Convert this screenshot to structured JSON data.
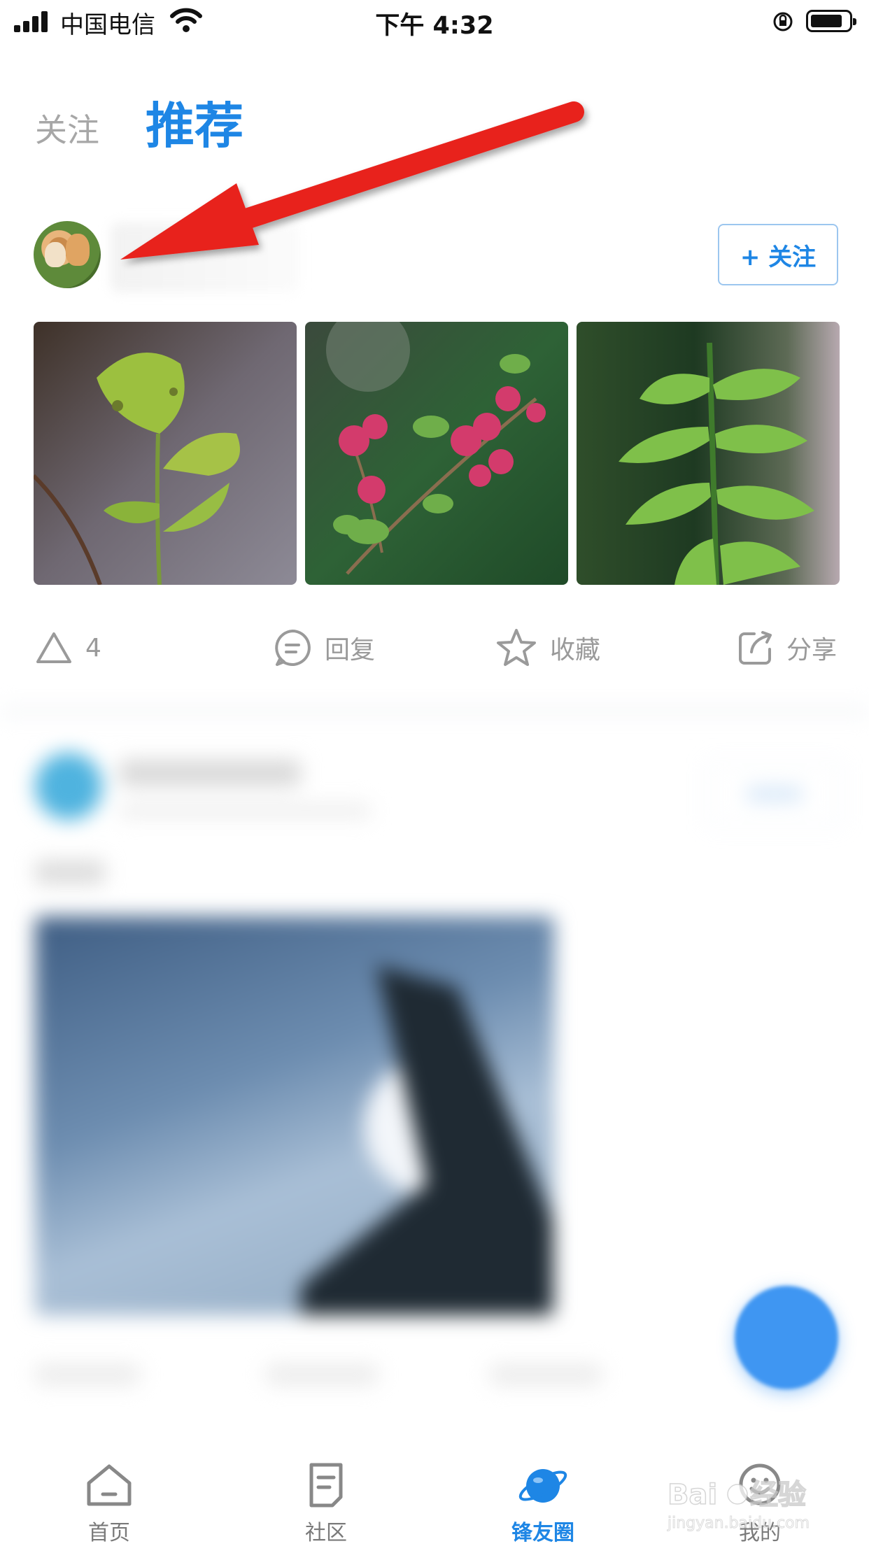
{
  "status_bar": {
    "carrier": "中国电信",
    "time": "下午 4:32"
  },
  "top_tabs": {
    "follow": "关注",
    "recommend": "推荐"
  },
  "post": {
    "follow_button": "+ 关注",
    "photos": [
      "leaf-photo",
      "bougainvillea-photo",
      "green-leaves-photo"
    ],
    "actions": {
      "like_count": "4",
      "reply": "回复",
      "favorite": "收藏",
      "share": "分享"
    }
  },
  "bottom_nav": {
    "items": [
      {
        "label": "首页",
        "icon": "home-icon"
      },
      {
        "label": "社区",
        "icon": "community-icon"
      },
      {
        "label": "锋友圈",
        "icon": "planet-icon"
      },
      {
        "label": "我的",
        "icon": "smile-icon"
      }
    ],
    "active": "锋友圈"
  },
  "colors": {
    "accent": "#1e86e5",
    "annotation_arrow": "#e8231f",
    "fab": "#3f96f2"
  }
}
